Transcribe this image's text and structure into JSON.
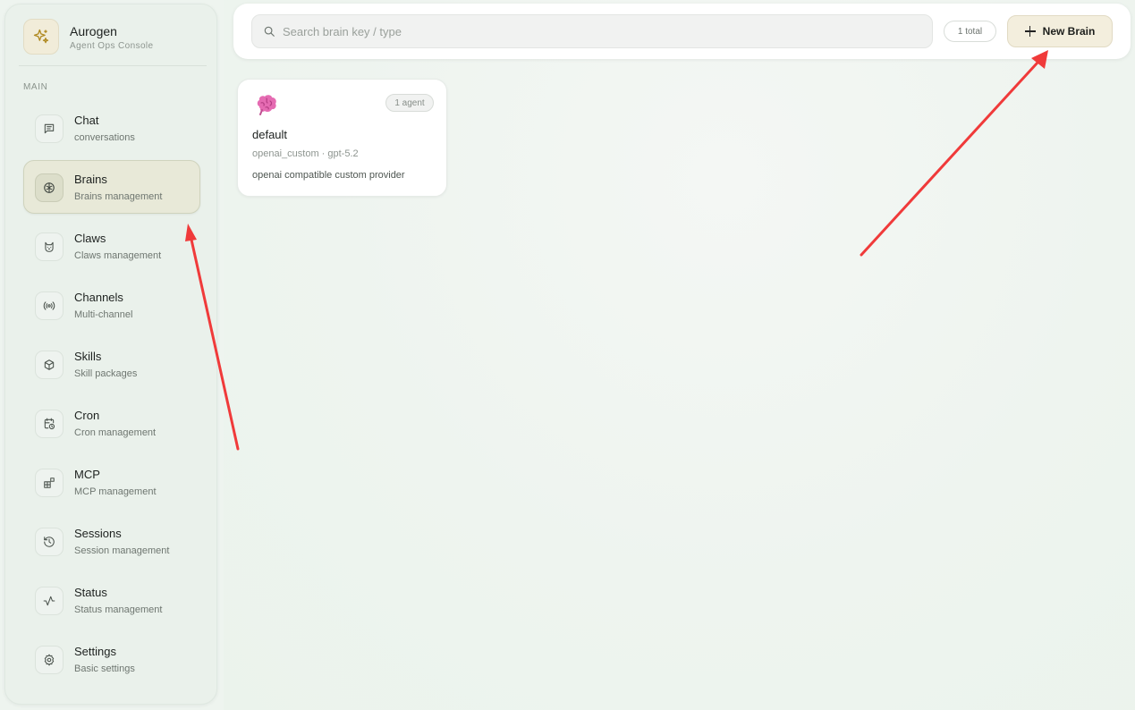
{
  "brand": {
    "title": "Aurogen",
    "subtitle": "Agent Ops Console",
    "icon": "sparkle-icon"
  },
  "sidebar": {
    "section_label": "MAIN",
    "items": [
      {
        "label": "Chat",
        "sub": "conversations",
        "icon": "chat-icon",
        "active": false
      },
      {
        "label": "Brains",
        "sub": "Brains management",
        "icon": "brain-icon",
        "active": true
      },
      {
        "label": "Claws",
        "sub": "Claws management",
        "icon": "cat-icon",
        "active": false
      },
      {
        "label": "Channels",
        "sub": "Multi-channel",
        "icon": "broadcast-icon",
        "active": false
      },
      {
        "label": "Skills",
        "sub": "Skill packages",
        "icon": "package-icon",
        "active": false
      },
      {
        "label": "Cron",
        "sub": "Cron management",
        "icon": "calendar-clock-icon",
        "active": false
      },
      {
        "label": "MCP",
        "sub": "MCP management",
        "icon": "blocks-icon",
        "active": false
      },
      {
        "label": "Sessions",
        "sub": "Session management",
        "icon": "history-icon",
        "active": false
      },
      {
        "label": "Status",
        "sub": "Status management",
        "icon": "activity-icon",
        "active": false
      },
      {
        "label": "Settings",
        "sub": "Basic settings",
        "icon": "gear-icon",
        "active": false
      }
    ]
  },
  "toolbar": {
    "search_placeholder": "Search brain key / type",
    "search_value": "",
    "total_label": "1 total",
    "new_button_label": "New Brain"
  },
  "brains": [
    {
      "icon": "brain-emoji",
      "agent_count_label": "1 agent",
      "name": "default",
      "meta": "openai_custom · gpt-5.2",
      "description": "openai compatible custom provider"
    }
  ],
  "colors": {
    "accent": "#f3eedd",
    "active_nav": "#e8e9d8",
    "background": "#eef4ef",
    "annotation_arrow": "#f03a3a"
  }
}
